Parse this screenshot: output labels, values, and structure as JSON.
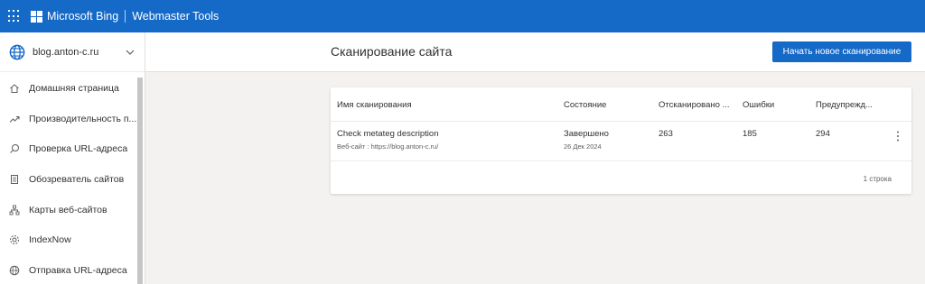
{
  "topbar": {
    "brand": "Microsoft Bing",
    "product": "Webmaster Tools"
  },
  "sidebar": {
    "site": "blog.anton-c.ru",
    "items": [
      {
        "label": "Домашняя страница",
        "icon": "home-icon"
      },
      {
        "label": "Производительность п...",
        "icon": "trend-icon"
      },
      {
        "label": "Проверка URL-адреса",
        "icon": "search-icon"
      },
      {
        "label": "Обозреватель сайтов",
        "icon": "document-icon"
      },
      {
        "label": "Карты веб-сайтов",
        "icon": "sitemap-icon"
      },
      {
        "label": "IndexNow",
        "icon": "gear-icon"
      },
      {
        "label": "Отправка URL-адреса",
        "icon": "globe-icon"
      }
    ]
  },
  "header": {
    "title": "Сканирование сайта",
    "new_scan_button": "Начать новое сканирование"
  },
  "table": {
    "columns": [
      "Имя сканирования",
      "Состояние",
      "Отсканировано ...",
      "Ошибки",
      "Предупрежд..."
    ],
    "rows": [
      {
        "name": "Check metateg description",
        "site": "Веб-сайт : https://blog.anton-c.ru/",
        "status": "Завершено",
        "date": "26 Дек 2024",
        "scanned": "263",
        "errors": "185",
        "warnings": "294"
      }
    ],
    "row_count": "1 строка"
  },
  "colors": {
    "accent": "#1569c7",
    "background": "#f3f2f1"
  }
}
